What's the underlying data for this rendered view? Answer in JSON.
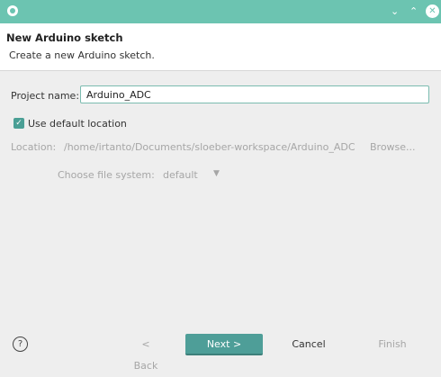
{
  "window": {
    "minimize_glyph": "⌄",
    "maximize_glyph": "⌃",
    "close_glyph": "✕",
    "accent_color": "#6cc4b1"
  },
  "header": {
    "title": "New Arduino sketch",
    "subtitle": "Create a new Arduino sketch."
  },
  "form": {
    "project_name_label": "Project name:",
    "project_name_value": "Arduino_ADC",
    "use_default_location_label": "Use default location",
    "use_default_location_checked": true,
    "location_label": "Location:",
    "location_value": "/home/irtanto/Documents/sloeber-workspace/Arduino_ADC",
    "browse_label": "Browse...",
    "file_system_label": "Choose file system:",
    "file_system_value": "default"
  },
  "footer": {
    "help_glyph": "?",
    "back_label": "< Back",
    "next_label": "Next >",
    "cancel_label": "Cancel",
    "finish_label": "Finish"
  }
}
